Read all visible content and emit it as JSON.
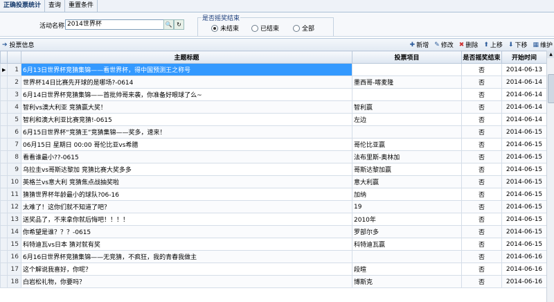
{
  "tabs": [
    "正确投票统计",
    "查询",
    "重置条件"
  ],
  "search": {
    "name_label": "活动名称",
    "name_value": "2014世界杯",
    "filter_legend": "是否摇奖结束",
    "radios": [
      {
        "label": "未结束",
        "checked": true
      },
      {
        "label": "已结束",
        "checked": false
      },
      {
        "label": "全部",
        "checked": false
      }
    ]
  },
  "toolbar": {
    "title": "投票信息",
    "add": "新增",
    "edit": "修改",
    "delete": "删除",
    "up": "上移",
    "down": "下移",
    "maintain": "维护"
  },
  "columns": [
    "主题标题",
    "投票项目",
    "是否摇奖结束",
    "开始时间"
  ],
  "rows": [
    {
      "n": "1",
      "title": "6月13日世界杯竞猜集锦——看世界杯，得中国预测王之称号",
      "item": "",
      "ended": "否",
      "start": "2014-06-13"
    },
    {
      "n": "2",
      "title": "世界杯14日比赛先开球的是哪场?-0614",
      "item": "墨西哥-喀麦隆",
      "ended": "否",
      "start": "2014-06-14"
    },
    {
      "n": "3",
      "title": "6月14日世界杯竞猜集锦——首批帅哥来袭，你准备好眼球了么~",
      "item": "",
      "ended": "否",
      "start": "2014-06-14"
    },
    {
      "n": "4",
      "title": "智利vs澳大利亚  竞猜赢大奖！",
      "item": "智利赢",
      "ended": "否",
      "start": "2014-06-14"
    },
    {
      "n": "5",
      "title": "智利和澳大利亚比赛竞猜!-0615",
      "item": "左边",
      "ended": "否",
      "start": "2014-06-14"
    },
    {
      "n": "6",
      "title": "6月15日世界杯“竞猜王”竞猜集锦——奖多，速来！",
      "item": "",
      "ended": "否",
      "start": "2014-06-15"
    },
    {
      "n": "7",
      "title": "06月15日 星期日 00:00 哥伦比亚vs希腊",
      "item": "哥伦比亚赢",
      "ended": "否",
      "start": "2014-06-15"
    },
    {
      "n": "8",
      "title": "看看谁最小??-0615",
      "item": "法布里斯-奥林加",
      "ended": "否",
      "start": "2014-06-15"
    },
    {
      "n": "9",
      "title": "乌拉圭vs哥斯达黎加  竞猜比赛大奖多多",
      "item": "哥斯达黎加赢",
      "ended": "否",
      "start": "2014-06-15"
    },
    {
      "n": "10",
      "title": "英格兰vs意大利  竞猜焦点战抽奖啦",
      "item": "意大利赢",
      "ended": "否",
      "start": "2014-06-15"
    },
    {
      "n": "11",
      "title": "猜猜世界杯年龄最小的球队?06-16",
      "item": "加纳",
      "ended": "否",
      "start": "2014-06-15"
    },
    {
      "n": "12",
      "title": "太难了！这你们就不知道了吧？",
      "item": "19",
      "ended": "否",
      "start": "2014-06-15"
    },
    {
      "n": "13",
      "title": "送奖品了，不来拿你就后悔吧！！！！",
      "item": "2010年",
      "ended": "否",
      "start": "2014-06-15"
    },
    {
      "n": "14",
      "title": "你希望是谁？？？-0615",
      "item": "罗部尔多",
      "ended": "否",
      "start": "2014-06-15"
    },
    {
      "n": "15",
      "title": "科特迪瓦vs日本 猜对就有奖",
      "item": "科特迪瓦赢",
      "ended": "否",
      "start": "2014-06-15"
    },
    {
      "n": "16",
      "title": "6月16日世界杯竞猜集锦——无竞猜，不疯狂，我的青春我做主",
      "item": "",
      "ended": "否",
      "start": "2014-06-16"
    },
    {
      "n": "17",
      "title": "这个解说我喜好，你呢？",
      "item": "段暄",
      "ended": "否",
      "start": "2014-06-16"
    },
    {
      "n": "18",
      "title": "白岩松礼物，你要吗？",
      "item": "博斯克",
      "ended": "否",
      "start": "2014-06-16"
    }
  ]
}
